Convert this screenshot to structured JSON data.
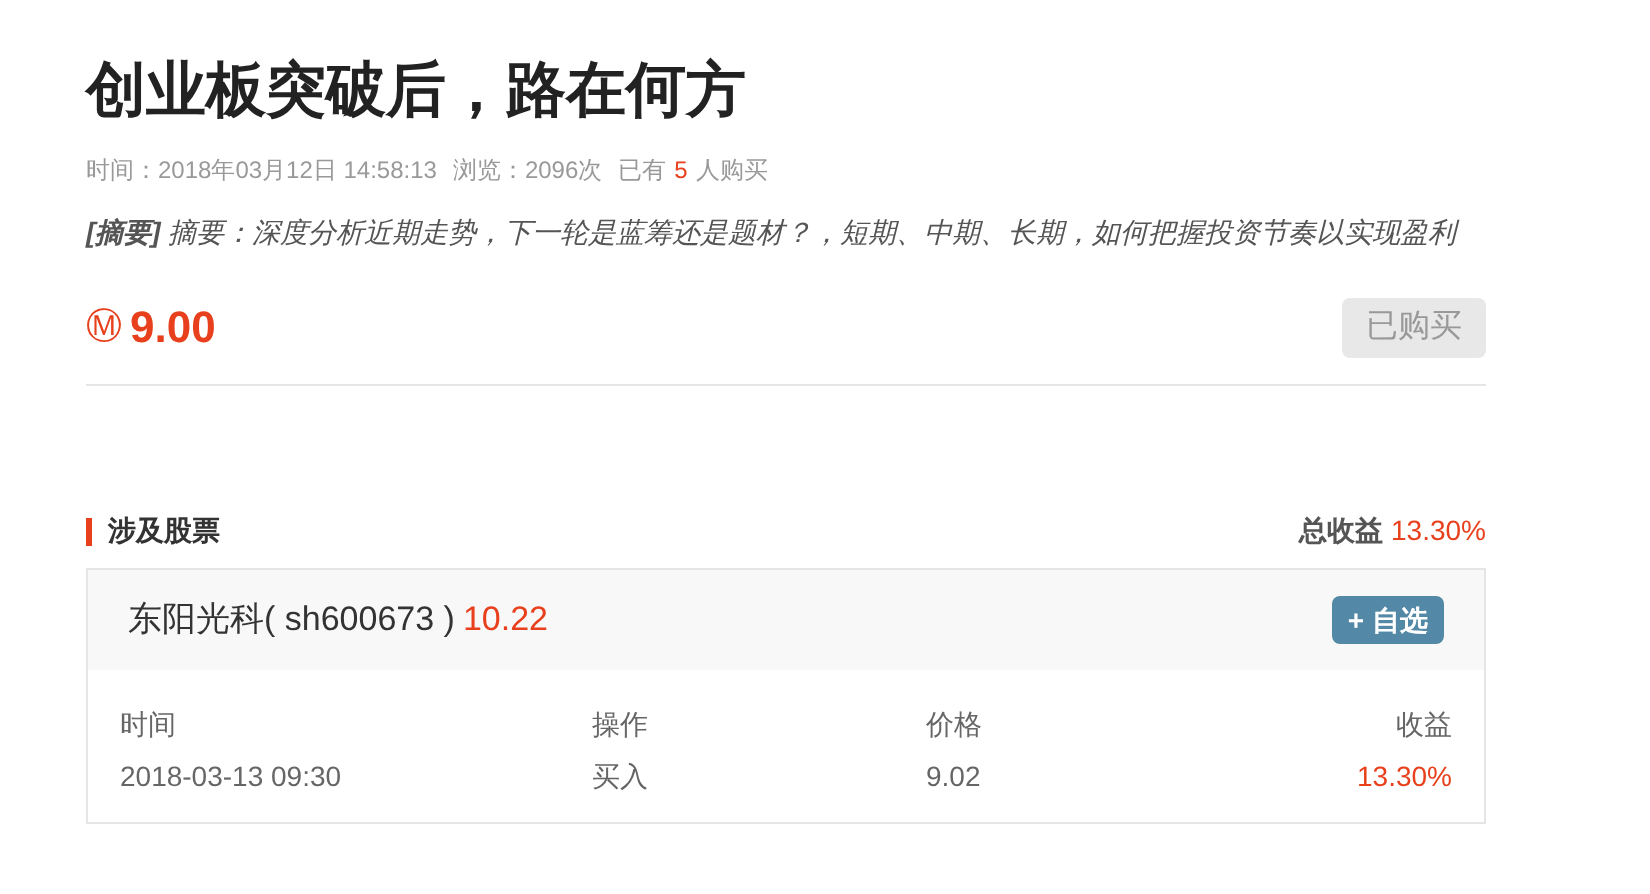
{
  "title": "创业板突破后，路在何方",
  "meta": {
    "time": "时间：2018年03月12日 14:58:13",
    "views": "浏览：2096次",
    "buyers_prefix": "已有",
    "buyers_count": "5",
    "buyers_suffix": "人购买"
  },
  "summary": "**[摘要]** 摘要：深度分析近期走势，下一轮是蓝筹还是题材？，短期、中期、长期，如何把握投资节奏以实现盈利",
  "price": {
    "symbol": "Ⓜ",
    "amount": "9.00"
  },
  "buy_button": {
    "label": "已购买",
    "disabled": true
  },
  "stocks_section": {
    "title": "涉及股票",
    "total_label": "总收益",
    "total_value": "13.30%"
  },
  "stock": {
    "name": "东阳光科( sh600673 )",
    "price": "10.22",
    "watch_button": "+ 自选"
  },
  "table": {
    "columns": [
      "时间",
      "操作",
      "价格",
      "收益"
    ],
    "rows": [
      {
        "cells": [
          "2018-03-13 09:30",
          "买入",
          "9.02",
          "13.30%"
        ]
      }
    ]
  }
}
